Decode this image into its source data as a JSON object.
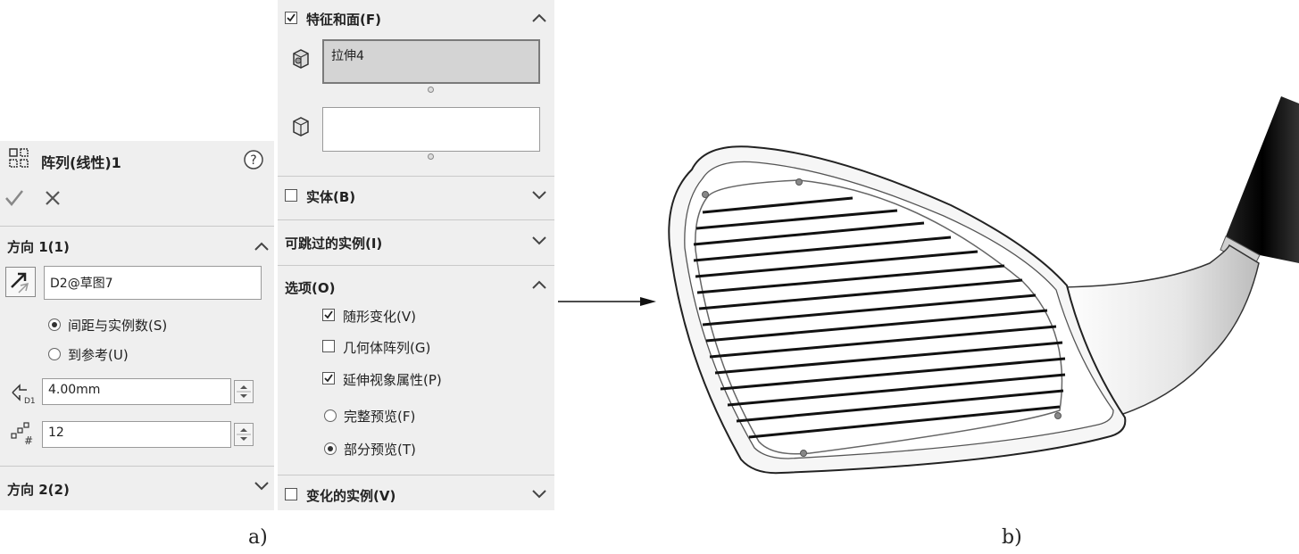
{
  "left_panel": {
    "title": "阵列(线性)1",
    "title_icon": "linear-pattern-icon",
    "help_icon": "help-icon",
    "ok_icon": "checkmark-icon",
    "cancel_icon": "close-icon",
    "direction1": {
      "label": "方向 1(1)",
      "reference": "D2@草图7",
      "radio_spacing": "间距与实例数(S)",
      "radio_reference": "到参考(U)",
      "selected_radio": "spacing",
      "spacing_value": "4.00mm",
      "instances_value": "12"
    },
    "direction2": {
      "label": "方向 2(2)"
    }
  },
  "mid_panel": {
    "features_faces": {
      "label": "特征和面(F)",
      "checked": true,
      "features_list": [
        "拉伸4"
      ],
      "faces_list": []
    },
    "bodies": {
      "label": "实体(B)",
      "checked": false
    },
    "skip_instances": {
      "label": "可跳过的实例(I)"
    },
    "options": {
      "label": "选项(O)",
      "vary_sketch": {
        "label": "随形变化(V)",
        "checked": true
      },
      "geometry_pattern": {
        "label": "几何体阵列(G)",
        "checked": false
      },
      "propagate_visual": {
        "label": "延伸视象属性(P)",
        "checked": true
      },
      "full_preview": {
        "label": "完整预览(F)",
        "selected": false
      },
      "partial_preview": {
        "label": "部分预览(T)",
        "selected": true
      }
    },
    "varied_instances": {
      "label": "变化的实例(V)",
      "checked": false
    }
  },
  "captions": {
    "a": "a)",
    "b": "b)"
  },
  "colors": {
    "panel_bg": "#efefef",
    "selected_field": "#d4d4d4",
    "selected_border": "#7a7a7a"
  }
}
